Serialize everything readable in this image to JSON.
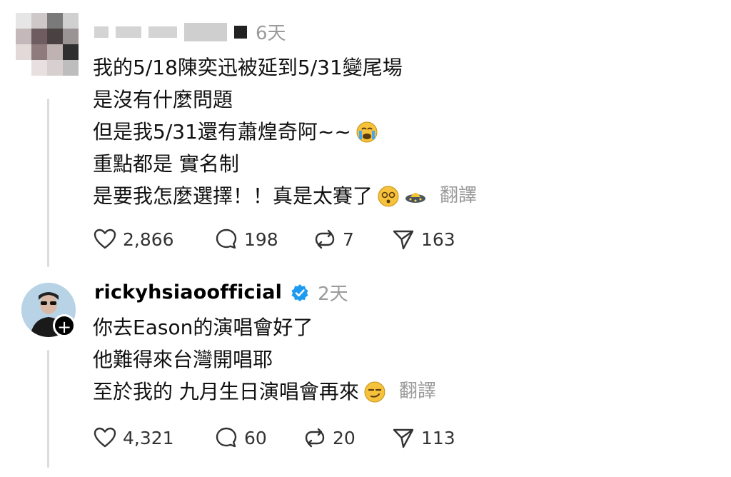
{
  "comment1": {
    "time": "6天",
    "lines": [
      "我的5/18陳奕迅被延到5/31變尾場",
      "是沒有什麼問題",
      "但是我5/31還有蕭煌奇阿~~",
      "重點都是 實名制",
      "是要我怎麼選擇！！真是太賽了"
    ],
    "translate_label": "翻譯",
    "actions": {
      "likes": "2,866",
      "replies": "198",
      "reposts": "7",
      "shares": "163"
    }
  },
  "comment2": {
    "username": "rickyhsiaoofficial",
    "time": "2天",
    "lines": [
      "你去Eason的演唱會好了",
      "他難得來台灣開唱耶",
      "至於我的 九月生日演唱會再來"
    ],
    "translate_label": "翻譯",
    "actions": {
      "likes": "4,321",
      "replies": "60",
      "reposts": "20",
      "shares": "113"
    }
  },
  "colors": {
    "verified": "#1d9bf0",
    "muted": "#9b9b9b",
    "thread_line": "#dcdcdc"
  },
  "icons": [
    "heart-icon",
    "comment-icon",
    "repost-icon",
    "share-icon",
    "verified-icon",
    "follow-plus-icon"
  ]
}
